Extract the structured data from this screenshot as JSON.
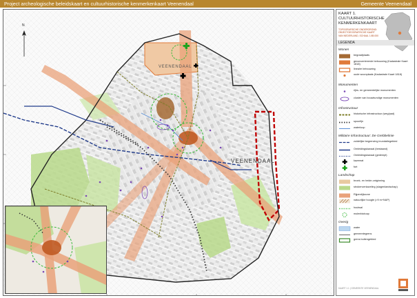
{
  "header": {
    "title": "Project archeologische beleidskaart en cultuurhistorische kenmerkenkaart Veenendaal",
    "org": "Gemeente Veenendaal"
  },
  "map": {
    "place_label": "VEENENDAAL",
    "place_label_north": "VEENENDAAL",
    "north_label": "N",
    "colors": {
      "built_old": "#e07a3a",
      "ridge": "#e9a27a",
      "green": "#b9d98b",
      "boundary": "#222222",
      "study_area": "#c00000",
      "canal": "#1f3a8a",
      "railway": "#333333"
    }
  },
  "kaart": {
    "title": "KAART 1.\nCULTUURHISTORISCHE KENMERKENKAART",
    "subtitle": "TOPOGRAFISCHE ONDERGROND: OBJECTGEOGRAFISCHE KAART VAN NEDERLAND, SCHAAL 1:85.000"
  },
  "legend": {
    "heading": "LEGENDA",
    "groups": [
      {
        "label": "Wonen",
        "items": [
          {
            "label": "begraafplaats",
            "icon": "brown-fill"
          },
          {
            "label": "geconcentreerde bebouwing (Kadastrale Kaart 1818)",
            "icon": "orange-fill"
          },
          {
            "label": "lineaire bebouwing",
            "icon": "orange-outline"
          },
          {
            "label": "oude woonplaats (Kadastrale Kaart 1818)",
            "icon": "orange-dot"
          }
        ]
      },
      {
        "label": "Monumenten",
        "items": [
          {
            "label": "rijks- en gemeentelijke monumenten",
            "icon": "purple-dot"
          },
          {
            "label": "cluster van bouwkundige monumenten",
            "icon": "purple-oval"
          }
        ]
      },
      {
        "label": "Infrastructuur",
        "items": [
          {
            "label": "historische infrastructuur (weg/pad)",
            "icon": "olive-line"
          },
          {
            "label": "spoorlijn",
            "icon": "rail-dots"
          },
          {
            "label": "waterloop",
            "icon": "blue-line"
          }
        ]
      },
      {
        "label": "Militaire infrastructuur: De Grebbelinie",
        "items": [
          {
            "label": "zuidelijke begrenzing inundatiegebied",
            "icon": "navy-dash"
          },
          {
            "label": "Omleidingskanaal (bestaand)",
            "icon": "navy-line"
          },
          {
            "label": "Omleidingskanaal (gedempt)",
            "icon": "navy-dotline"
          },
          {
            "label": "kazemat",
            "icon": "black-cross"
          },
          {
            "label": "fort",
            "icon": "green-cross"
          }
        ]
      },
      {
        "label": "Landschap",
        "items": [
          {
            "label": "broek- en heide-ontginning",
            "icon": "tan-fill"
          },
          {
            "label": "strokenverkaveling (slagenlandschap)",
            "icon": "green-fill"
          },
          {
            "label": "Rijperdijkzone",
            "icon": "salmon-fill"
          },
          {
            "label": "natuurlijke hoogte (>9 m+NAP)",
            "icon": "brown-hatch"
          },
          {
            "label": "houtwal",
            "icon": "green-dots"
          },
          {
            "label": "molenbiotoop",
            "icon": "green-dashcircle"
          }
        ]
      },
      {
        "label": "Overig",
        "items": [
          {
            "label": "water",
            "icon": "water-fill"
          },
          {
            "label": "gemeentegrens",
            "icon": "grey-line"
          },
          {
            "label": "grens buitengebied",
            "icon": "green-outline"
          }
        ]
      }
    ]
  },
  "brand": {
    "footer": "KAART 1.1 | GEMEENTE VEENENDAAL"
  }
}
